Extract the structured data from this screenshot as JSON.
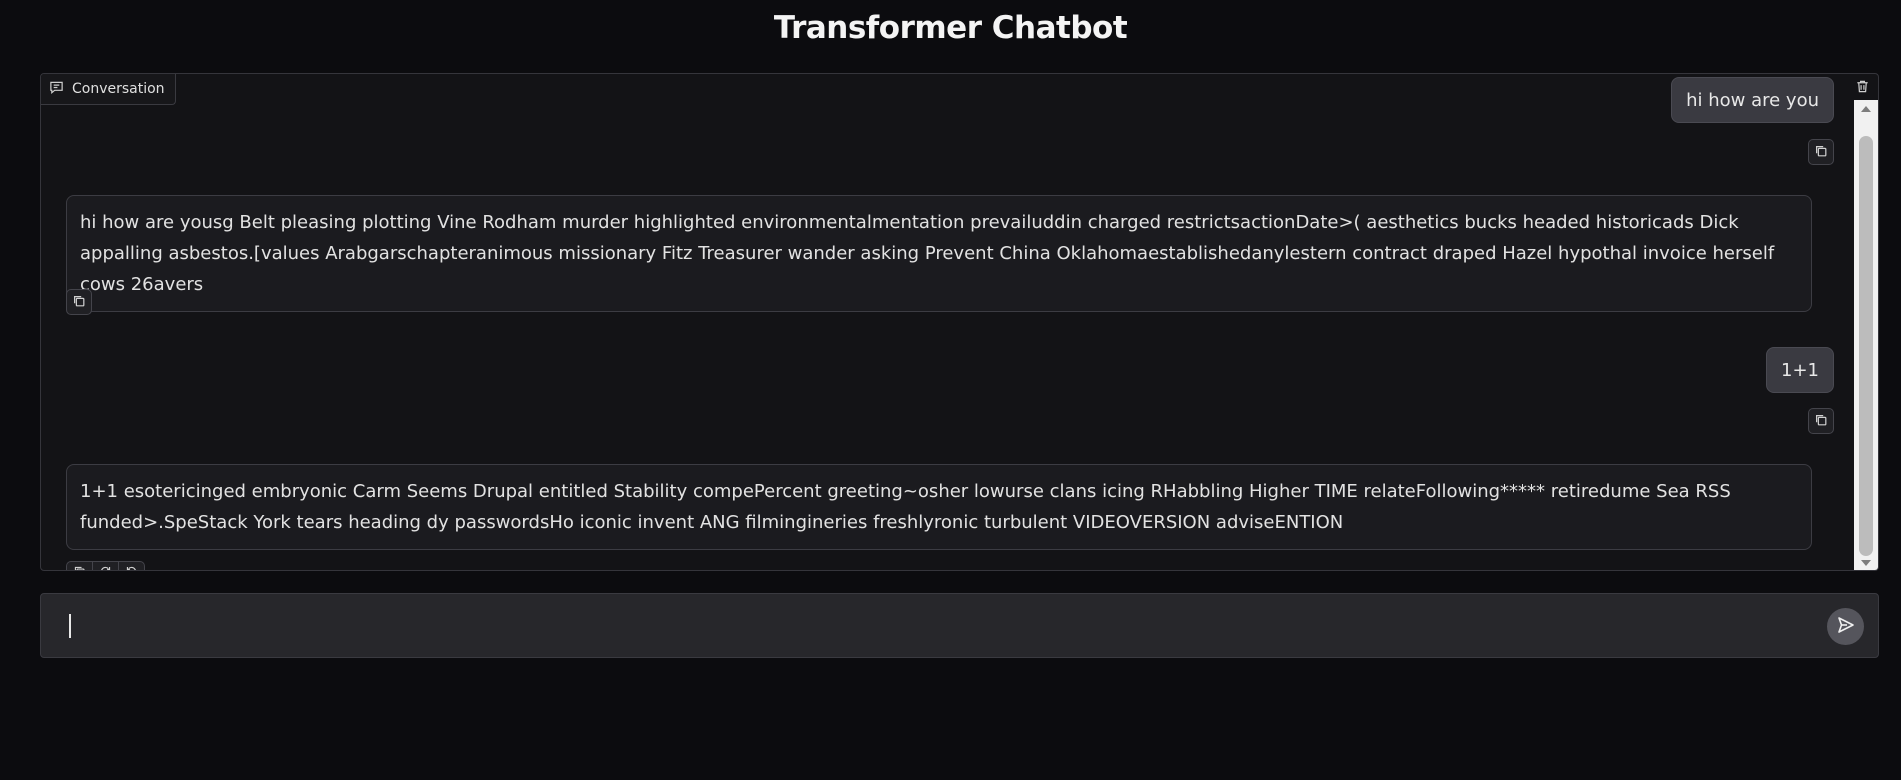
{
  "app": {
    "title": "Transformer Chatbot"
  },
  "chatbot": {
    "label": "Conversation",
    "label_icon": "chat-icon",
    "clear_icon": "trash-icon",
    "messages": [
      {
        "role": "user",
        "text": "hi how are you"
      },
      {
        "role": "bot",
        "text": "hi how are yousg Belt pleasing plotting Vine Rodham murder highlighted environmentalmentation prevailuddin charged restrictsactionDate>( aesthetics bucks headed historicads Dick appalling asbestos.[values Arabgarschapteranimous missionary Fitz Treasurer wander asking Prevent China Oklahomaestablishedanylestern contract draped Hazel hypothal invoice herself cows 26avers"
      },
      {
        "role": "user",
        "text": "1+1"
      },
      {
        "role": "bot",
        "text": "1+1 esotericinged embryonic Carm Seems Drupal entitled Stability compePercent greeting~osher lowurse clans icing RHabbling Higher TIME relateFollowing***** retiredume Sea RSS funded>.SpeStack York tears heading dy passwordsHo iconic invent ANG filmingineries freshlyronic turbulent VIDEOVERSION adviseENTION"
      }
    ],
    "message_actions": [
      "copy-icon",
      "retry-icon",
      "undo-icon"
    ]
  },
  "input": {
    "value": "",
    "placeholder": "",
    "send_icon": "send-icon"
  },
  "colors": {
    "background": "#0c0c0f",
    "panel": "#131316",
    "user_bubble": "#3a3a41",
    "bot_bubble": "#1b1b1f",
    "input_bg": "#27272b"
  }
}
